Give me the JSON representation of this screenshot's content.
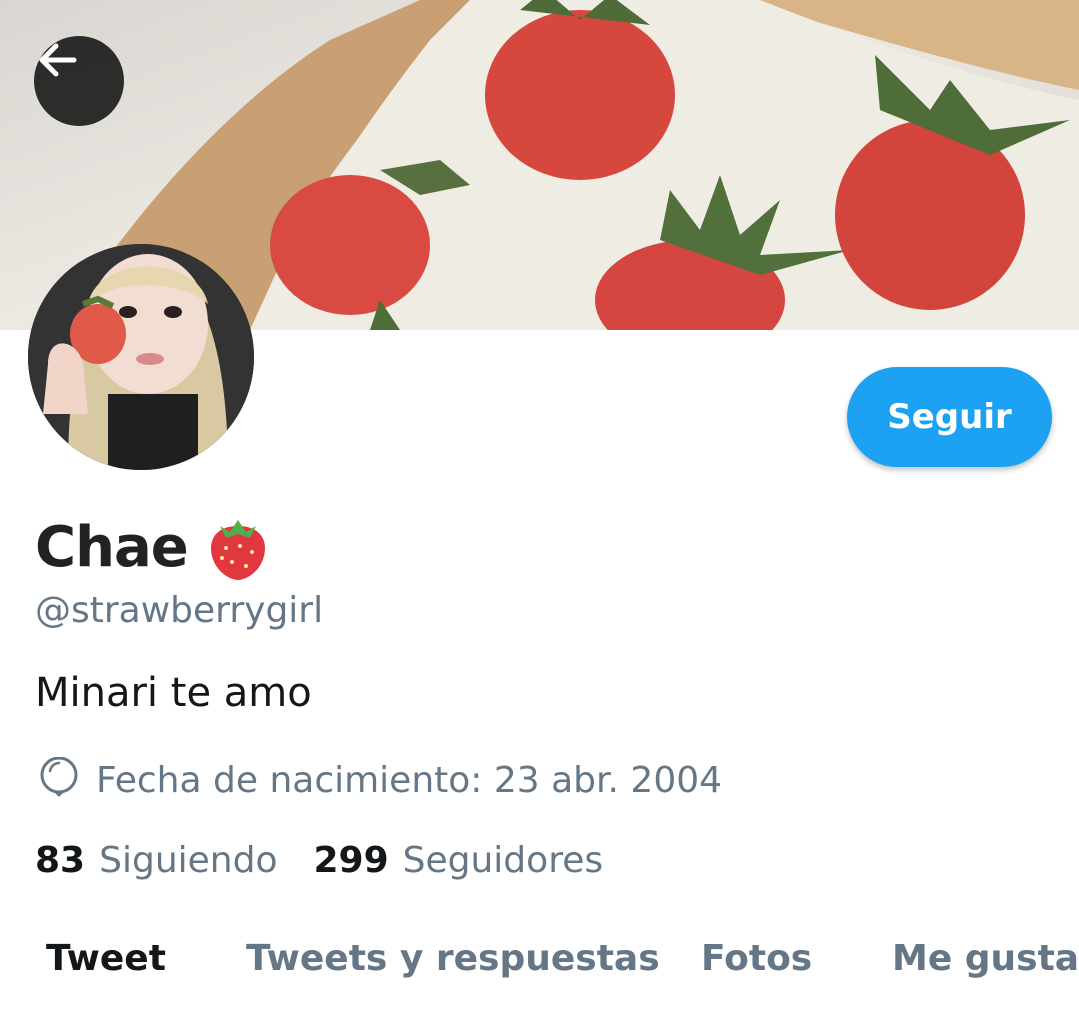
{
  "header": {
    "back_icon": "arrow-left-icon",
    "banner_description_icon": "strawberry-cake-banner"
  },
  "profile": {
    "name": "Chae",
    "name_emoji": "strawberry-icon",
    "handle": "@strawberrygirl",
    "bio": "Minari te amo",
    "birth_icon": "balloon-icon",
    "birth_text": "Fecha de nacimiento: 23 abr. 2004",
    "follow_label": "Seguir"
  },
  "stats": {
    "following_count": "83",
    "following_label": "Siguiendo",
    "followers_count": "299",
    "followers_label": "Seguidores"
  },
  "tabs": [
    {
      "label": "Tweet",
      "active": true
    },
    {
      "label": "Tweets y respuestas",
      "active": false
    },
    {
      "label": "Fotos",
      "active": false
    },
    {
      "label": "Me gusta",
      "active": false
    }
  ],
  "colors": {
    "accent": "#1da1f2",
    "secondary_text": "#657786",
    "primary_text": "#14171a"
  }
}
